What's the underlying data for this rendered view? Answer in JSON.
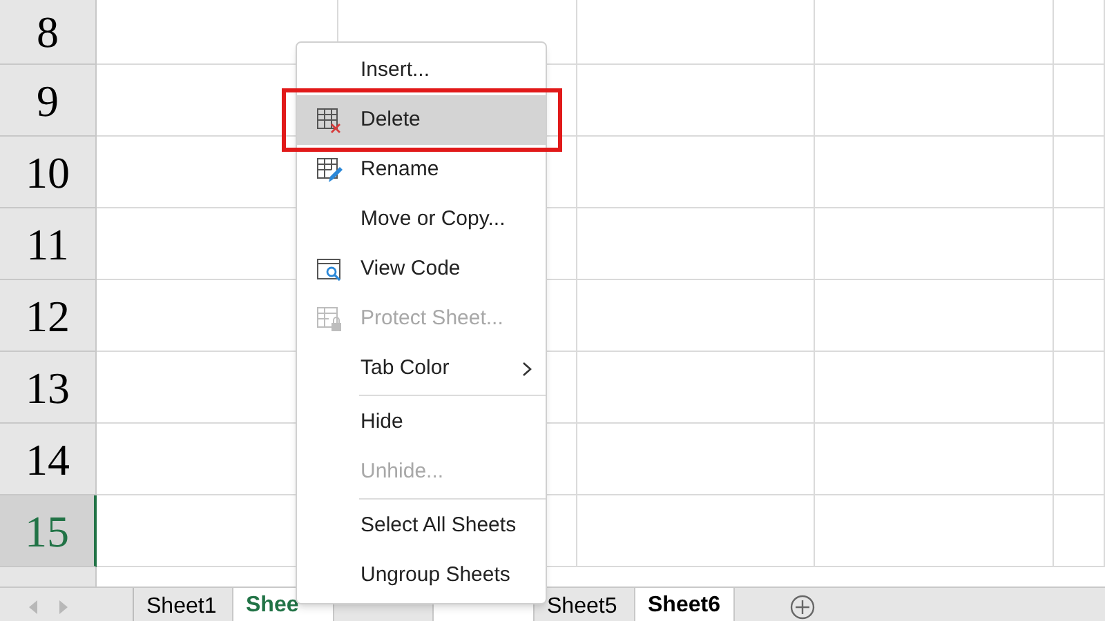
{
  "rows": [
    {
      "label": "8",
      "selected": false
    },
    {
      "label": "9",
      "selected": false
    },
    {
      "label": "10",
      "selected": false
    },
    {
      "label": "11",
      "selected": false
    },
    {
      "label": "12",
      "selected": false
    },
    {
      "label": "13",
      "selected": false
    },
    {
      "label": "14",
      "selected": false
    },
    {
      "label": "15",
      "selected": true
    }
  ],
  "sheet_tabs": [
    {
      "label": "Sheet1",
      "selected": false,
      "active": false
    },
    {
      "label": "Shee",
      "selected": true,
      "active": true
    },
    {
      "selected": false
    },
    {
      "selected": true
    },
    {
      "label": "Sheet5",
      "selected": false,
      "active": false
    },
    {
      "label": "Sheet6",
      "selected": true,
      "active": false
    }
  ],
  "context_menu": [
    {
      "kind": "item",
      "label": "Insert...",
      "disabled": false,
      "highlighted": false,
      "outlined": false
    },
    {
      "kind": "item",
      "label": "Delete",
      "disabled": false,
      "highlighted": true,
      "outlined": true
    },
    {
      "kind": "item",
      "label": "Rename",
      "disabled": false,
      "highlighted": false,
      "outlined": false
    },
    {
      "kind": "item",
      "label": "Move or Copy...",
      "disabled": false,
      "highlighted": false,
      "outlined": false
    },
    {
      "kind": "item",
      "label": "View Code",
      "disabled": false,
      "highlighted": false,
      "outlined": false
    },
    {
      "kind": "item",
      "label": "Protect Sheet...",
      "disabled": true,
      "highlighted": false,
      "outlined": false
    },
    {
      "kind": "item",
      "label": "Tab Color",
      "submenu": true,
      "disabled": false,
      "highlighted": false,
      "outlined": false
    },
    {
      "kind": "separator"
    },
    {
      "kind": "item",
      "label": "Hide",
      "disabled": false,
      "highlighted": false,
      "outlined": false
    },
    {
      "kind": "item",
      "label": "Unhide...",
      "disabled": true,
      "highlighted": false,
      "outlined": false
    },
    {
      "kind": "separator"
    },
    {
      "kind": "item",
      "label": "Select All Sheets",
      "disabled": false,
      "highlighted": false,
      "outlined": false
    },
    {
      "kind": "item",
      "label": "Ungroup Sheets",
      "disabled": false,
      "highlighted": false,
      "outlined": false
    }
  ]
}
